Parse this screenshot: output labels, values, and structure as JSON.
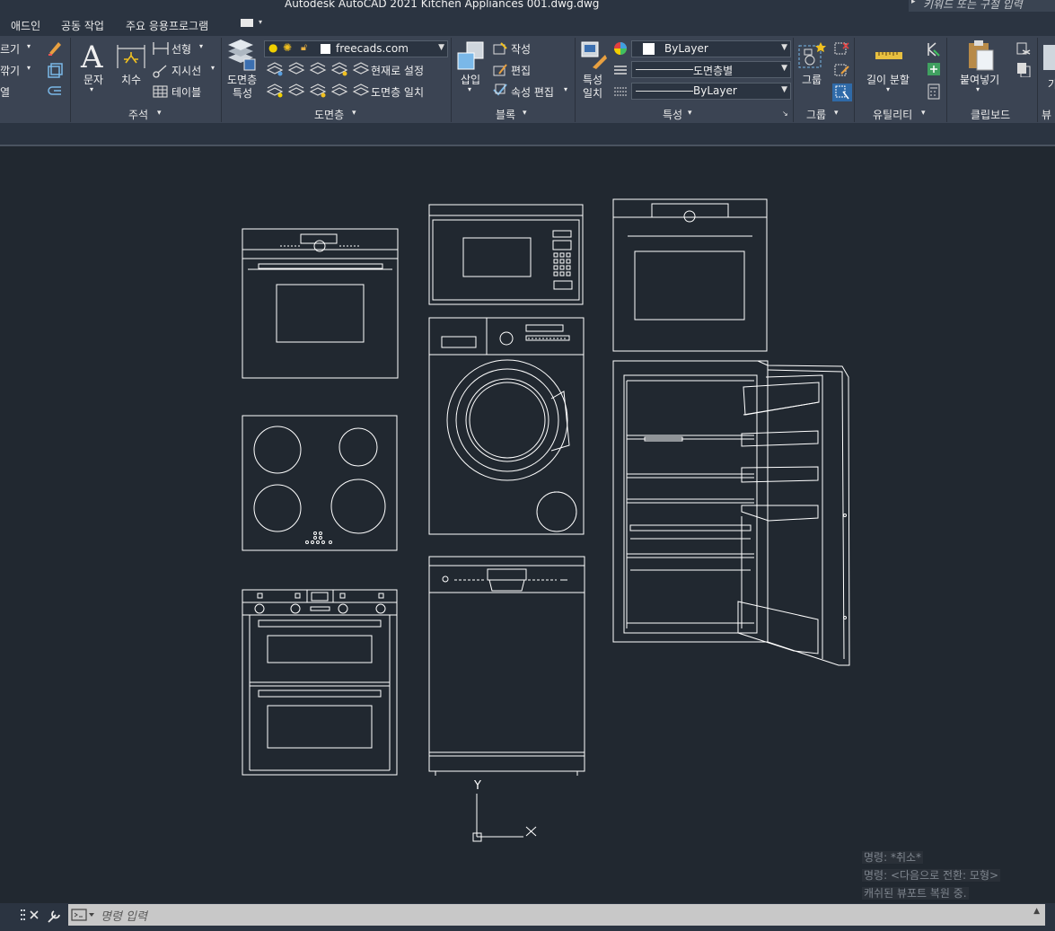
{
  "window": {
    "title": "Autodesk AutoCAD 2021    Kitchen Appliances 001.dwg.dwg"
  },
  "search": {
    "placeholder": "키워드 또는 구절 입력"
  },
  "menu": {
    "items": [
      "애드인",
      "공동 작업",
      "주요 응용프로그램"
    ]
  },
  "ribbon": {
    "draw_partial": {
      "items": [
        "르기",
        "깎기",
        "열"
      ]
    },
    "annotation": {
      "title": "주석",
      "text_label": "문자",
      "dim_label": "치수",
      "linear_label": "선형",
      "leader_label": "지시선",
      "table_label": "테이블"
    },
    "layers": {
      "title": "도면층",
      "props_label_1": "도면층",
      "props_label_2": "특성",
      "combo_value": "freecads.com",
      "set_current": "현재로 설정",
      "match_layer": "도면층 일치"
    },
    "block": {
      "title": "블록",
      "insert_label": "삽입",
      "create": "작성",
      "edit": "편집",
      "edit_attributes": "속성 편집"
    },
    "properties": {
      "title": "특성",
      "match_label_1": "특성",
      "match_label_2": "일치",
      "color_value": "ByLayer",
      "linetype_value": "도면층별",
      "lineweight_value": "ByLayer"
    },
    "groups": {
      "title": "그룹",
      "group_label": "그룹"
    },
    "utilities": {
      "title": "유틸리티",
      "measure_label": "길이 분할"
    },
    "clipboard": {
      "title": "클립보드",
      "paste_label": "붙여넣기"
    },
    "view_partial": {
      "title": "뷰",
      "label": "가"
    }
  },
  "ucs": {
    "y": "Y",
    "x": "X"
  },
  "history": [
    "명령: *취소*",
    "명령:   <다음으로 전환: 모형>",
    "캐쉬된 뷰포트 복원 중."
  ],
  "command": {
    "placeholder": "명령 입력"
  },
  "colors": {
    "canvas": "#212830",
    "ribbon": "#3b4453",
    "menubar": "#2b3441",
    "linework": "#ffffff"
  }
}
